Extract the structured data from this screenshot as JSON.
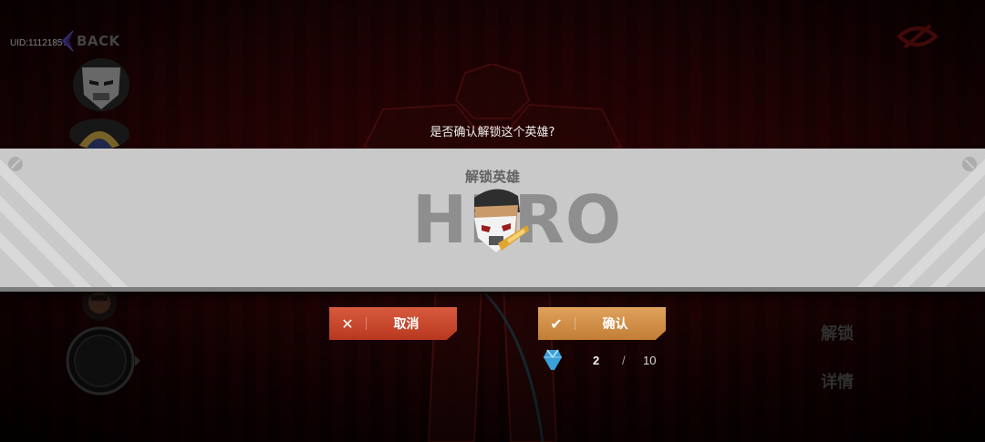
{
  "header": {
    "uid": "UID:11121857",
    "back_label": "BACK"
  },
  "side_menu": {
    "unlock": "解锁",
    "details": "详情"
  },
  "dialog": {
    "question": "是否确认解锁这个英雄?",
    "title": "解锁英雄",
    "watermark": "HERO",
    "cancel_label": "取消",
    "confirm_label": "确认",
    "cost": {
      "current": "2",
      "separator": "/",
      "required": "10"
    }
  },
  "icons": {
    "cancel": "close-icon",
    "confirm": "checkmark-icon",
    "cost": "shard-icon"
  },
  "colors": {
    "cancel_button": "#c94a2e",
    "confirm_button": "#d4904a",
    "dialog_band": "#c9c9c9",
    "background": "#2a0507"
  }
}
